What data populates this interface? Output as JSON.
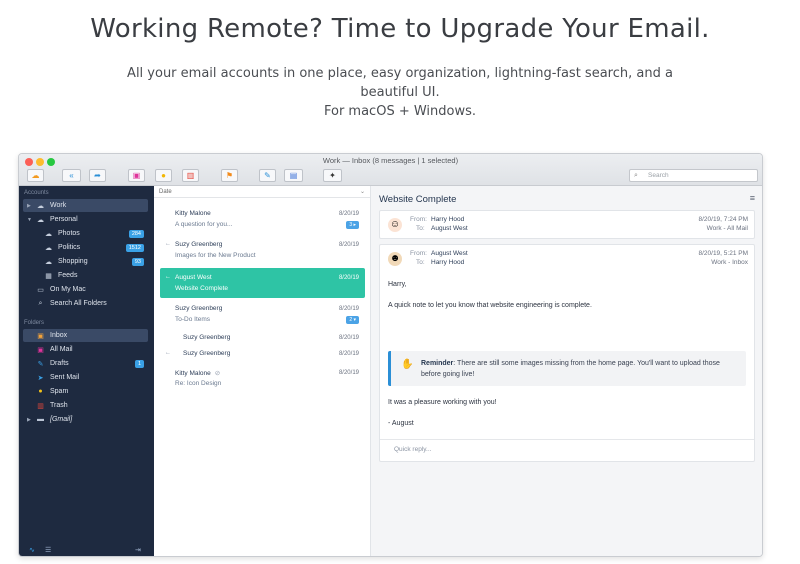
{
  "hero": {
    "title": "Working Remote? Time to Upgrade Your Email.",
    "subtitle_line1": "All your email accounts in one place, easy organization, lightning-fast search, and a beautiful UI.",
    "subtitle_line2": "For macOS + Windows."
  },
  "window": {
    "title": "Work — Inbox (8 messages | 1 selected)",
    "search_placeholder": "Search"
  },
  "toolbar": {
    "icons": [
      "cloud-icon",
      "reply-all-icon",
      "forward-icon",
      "archive-icon",
      "snooze-icon",
      "trash-icon",
      "flag-icon",
      "compose-icon",
      "contacts-icon",
      "sweep-icon"
    ]
  },
  "sidebar": {
    "accounts_heading": "Accounts",
    "accounts": [
      {
        "label": "Work",
        "icon": "cloud-icon",
        "badge": ""
      },
      {
        "label": "Personal",
        "icon": "cloud-icon",
        "badge": ""
      },
      {
        "label": "Photos",
        "icon": "cloud-icon",
        "badge": "284"
      },
      {
        "label": "Politics",
        "icon": "cloud-icon",
        "badge": "1512"
      },
      {
        "label": "Shopping",
        "icon": "cloud-icon",
        "badge": "93"
      },
      {
        "label": "Feeds",
        "icon": "rss-icon",
        "badge": ""
      },
      {
        "label": "On My Mac",
        "icon": "monitor-icon",
        "badge": ""
      },
      {
        "label": "Search All Folders",
        "icon": "search-icon",
        "badge": ""
      }
    ],
    "folders_heading": "Folders",
    "folders": [
      {
        "label": "Inbox",
        "icon": "inbox-icon",
        "badge": ""
      },
      {
        "label": "All Mail",
        "icon": "all-mail-icon",
        "badge": ""
      },
      {
        "label": "Drafts",
        "icon": "pencil-icon",
        "badge": "1"
      },
      {
        "label": "Sent Mail",
        "icon": "send-icon",
        "badge": ""
      },
      {
        "label": "Spam",
        "icon": "spam-icon",
        "badge": ""
      },
      {
        "label": "Trash",
        "icon": "trash-icon",
        "badge": ""
      },
      {
        "label": "[Gmail]",
        "icon": "folder-icon",
        "badge": ""
      }
    ]
  },
  "message_list": {
    "sort_label": "Date",
    "messages": [
      {
        "from": "Kitty Malone",
        "subject": "A question for you...",
        "date": "8/20/19",
        "badge": "3 ▸",
        "arrow": ""
      },
      {
        "from": "Suzy Greenberg",
        "subject": "Images for the New Product",
        "date": "8/20/19",
        "badge": "",
        "arrow": "←"
      },
      {
        "from": "August West",
        "subject": "Website Complete",
        "date": "8/20/19",
        "badge": "",
        "arrow": "←"
      },
      {
        "from": "Suzy Greenberg",
        "subject": "To-Do Items",
        "date": "8/20/19",
        "badge": "2 ▾",
        "arrow": ""
      },
      {
        "from": "Suzy Greenberg",
        "subject": "",
        "date": "8/20/19",
        "badge": "",
        "arrow": ""
      },
      {
        "from": "Suzy Greenberg",
        "subject": "",
        "date": "8/20/19",
        "badge": "",
        "arrow": "←"
      },
      {
        "from": "Kitty Malone",
        "subject": "Re: Icon Design",
        "date": "8/20/19",
        "badge": "",
        "arrow": ""
      }
    ]
  },
  "reader": {
    "title": "Website Complete",
    "header1": {
      "from_key": "From:",
      "from": "Harry Hood",
      "to_key": "To:",
      "to": "August West",
      "date": "8/20/19, 7:24 PM",
      "folder": "Work - All Mail"
    },
    "header2": {
      "from_key": "From:",
      "from": "August West",
      "to_key": "To:",
      "to": "Harry Hood",
      "date": "8/20/19, 5:21 PM",
      "folder": "Work - Inbox"
    },
    "greeting": "Harry,",
    "body1": "A quick note to let you know that website engineering is complete.",
    "reminder_label": "Reminder",
    "reminder_text": ": There are still some images missing from the home page. You'll want to upload those before going live!",
    "body2": "It was a pleasure working with you!",
    "signoff": "- August",
    "quick_reply": "Quick reply..."
  },
  "colors": {
    "sidebar_bg": "#1e2a40",
    "selected_message": "#2ec4a5",
    "accent_blue": "#2b8fd6"
  }
}
